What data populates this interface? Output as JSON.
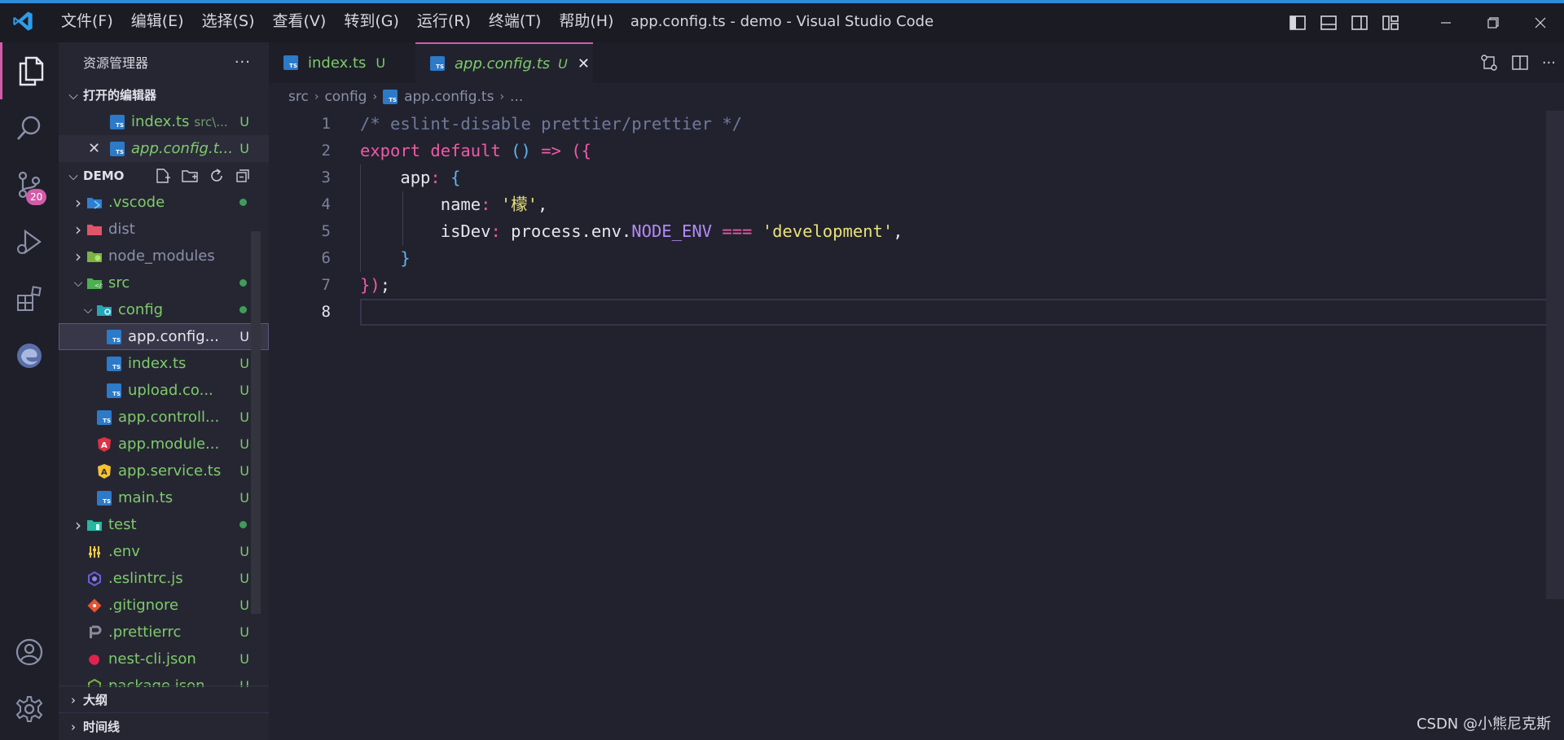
{
  "titlebar": {
    "menu": [
      "文件(F)",
      "编辑(E)",
      "选择(S)",
      "查看(V)",
      "转到(G)",
      "运行(R)",
      "终端(T)",
      "帮助(H)"
    ],
    "window_title": "app.config.ts - demo - Visual Studio Code"
  },
  "activity_bar": {
    "scm_badge": "20"
  },
  "sidebar": {
    "title": "资源管理器",
    "more_label": "···",
    "open_editors": {
      "label": "打开的编辑器",
      "items": [
        {
          "name": "index.ts",
          "path": "src\\...",
          "status": "U"
        },
        {
          "name": "app.config.t...",
          "status": "U"
        }
      ]
    },
    "workspace": {
      "label": "DEMO",
      "items": [
        {
          "name": ".vscode",
          "indent": 1,
          "kind": "folder",
          "icon": "vscode-folder-icon",
          "dot": true,
          "status": ""
        },
        {
          "name": "dist",
          "indent": 1,
          "kind": "folder",
          "icon": "dist-folder-icon",
          "dot": false,
          "status": ""
        },
        {
          "name": "node_modules",
          "indent": 1,
          "kind": "folder",
          "icon": "node-folder-icon",
          "dot": false,
          "status": ""
        },
        {
          "name": "src",
          "indent": 1,
          "kind": "folder-open",
          "icon": "src-folder-icon",
          "dot": true,
          "status": ""
        },
        {
          "name": "config",
          "indent": 2,
          "kind": "folder-open",
          "icon": "config-folder-icon",
          "dot": true,
          "status": ""
        },
        {
          "name": "app.config...",
          "indent": 3,
          "kind": "file",
          "icon": "ts-file-icon",
          "dot": false,
          "status": "U",
          "selected": true
        },
        {
          "name": "index.ts",
          "indent": 3,
          "kind": "file",
          "icon": "ts-file-icon",
          "dot": false,
          "status": "U"
        },
        {
          "name": "upload.co...",
          "indent": 3,
          "kind": "file",
          "icon": "ts-file-icon",
          "dot": false,
          "status": "U"
        },
        {
          "name": "app.controll...",
          "indent": 2,
          "kind": "file",
          "icon": "ts-file-icon",
          "dot": false,
          "status": "U"
        },
        {
          "name": "app.module...",
          "indent": 2,
          "kind": "file",
          "icon": "angular-file-icon",
          "dot": false,
          "status": "U"
        },
        {
          "name": "app.service.ts",
          "indent": 2,
          "kind": "file",
          "icon": "angular-service-icon",
          "dot": false,
          "status": "U"
        },
        {
          "name": "main.ts",
          "indent": 2,
          "kind": "file",
          "icon": "ts-file-icon",
          "dot": false,
          "status": "U"
        },
        {
          "name": "test",
          "indent": 1,
          "kind": "folder",
          "icon": "test-folder-icon",
          "dot": true,
          "status": ""
        },
        {
          "name": ".env",
          "indent": 1,
          "kind": "file",
          "icon": "env-file-icon",
          "dot": false,
          "status": "U"
        },
        {
          "name": ".eslintrc.js",
          "indent": 1,
          "kind": "file",
          "icon": "eslint-file-icon",
          "dot": false,
          "status": "U"
        },
        {
          "name": ".gitignore",
          "indent": 1,
          "kind": "file",
          "icon": "git-file-icon",
          "dot": false,
          "status": "U"
        },
        {
          "name": ".prettierrc",
          "indent": 1,
          "kind": "file",
          "icon": "prettier-file-icon",
          "dot": false,
          "status": "U"
        },
        {
          "name": "nest-cli.json",
          "indent": 1,
          "kind": "file",
          "icon": "nest-file-icon",
          "dot": false,
          "status": "U"
        },
        {
          "name": "package.json",
          "indent": 1,
          "kind": "file",
          "icon": "npm-file-icon",
          "dot": false,
          "status": "U"
        }
      ]
    },
    "outline_label": "大纲",
    "timeline_label": "时间线"
  },
  "tabs": [
    {
      "label": "index.ts",
      "status": "U",
      "active": false
    },
    {
      "label": "app.config.ts",
      "status": "U",
      "active": true
    }
  ],
  "breadcrumb": [
    "src",
    "config",
    "app.config.ts",
    "..."
  ],
  "editor": {
    "line_numbers": [
      "1",
      "2",
      "3",
      "4",
      "5",
      "6",
      "7",
      "8"
    ],
    "current_line": 8
  },
  "watermark": "CSDN @小熊尼克斯",
  "colors": {
    "accent": "#d15ca8",
    "untracked": "#7ecb6a",
    "keyword": "#f05aa8",
    "string": "#e8e27a",
    "constant": "#b48af7"
  }
}
